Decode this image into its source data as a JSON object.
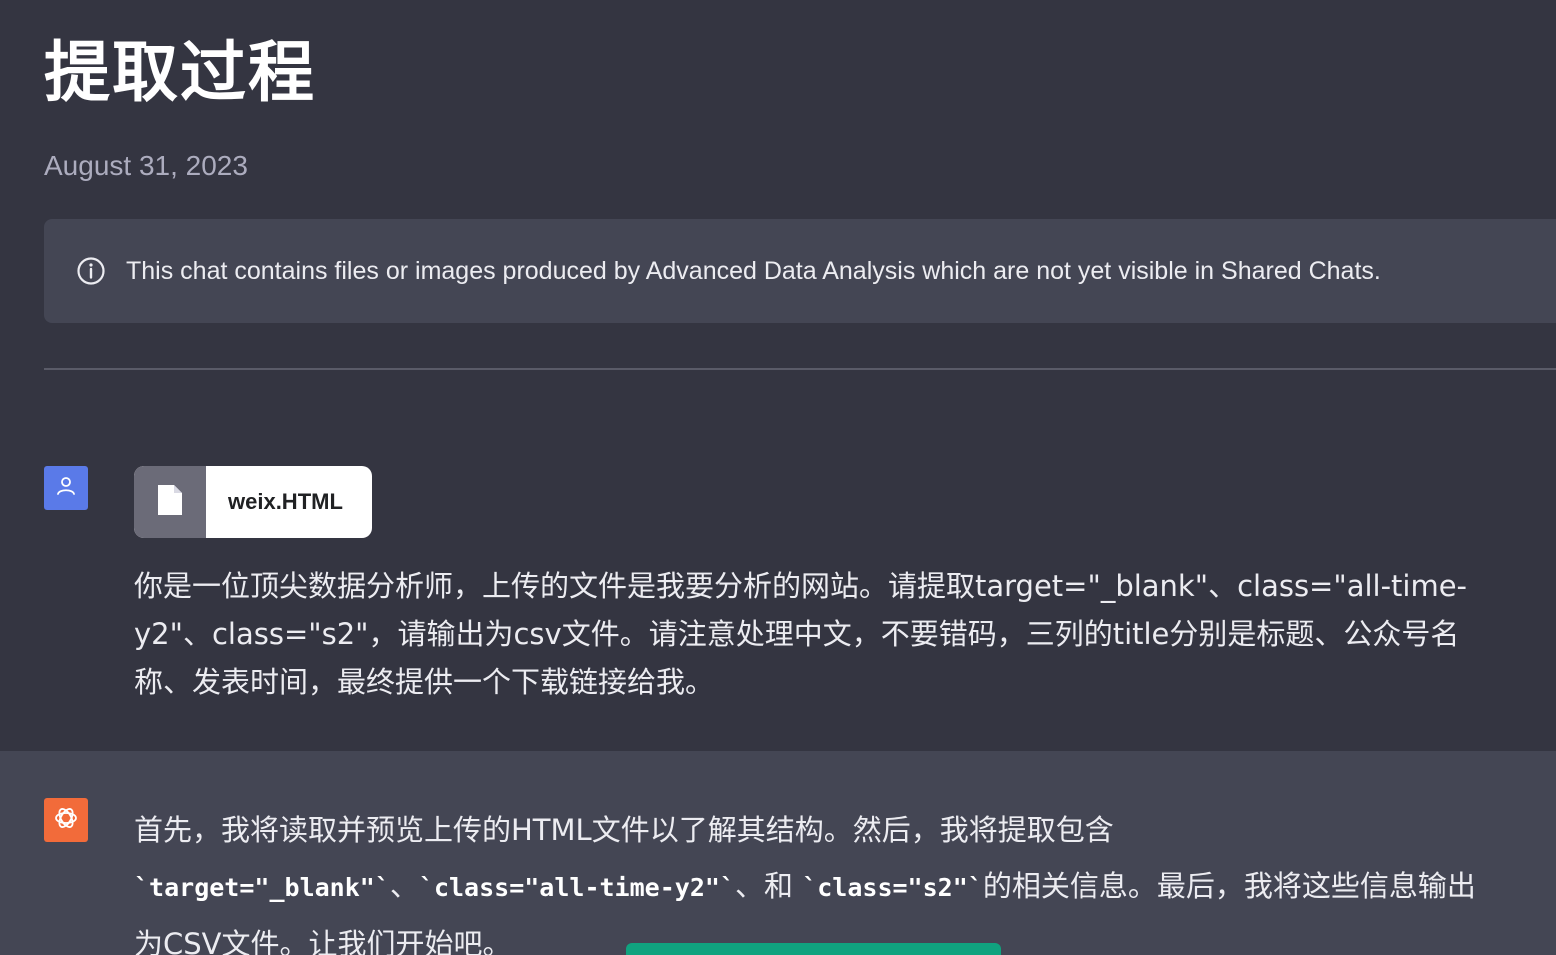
{
  "page": {
    "title": "提取过程",
    "date": "August 31, 2023"
  },
  "notice": {
    "icon": "info-icon",
    "text": "This chat contains files or images produced by Advanced Data Analysis which are not yet visible in Shared Chats."
  },
  "user_message": {
    "avatar_icon": "user-icon",
    "avatar_color": "#5a7ae8",
    "attachment": {
      "icon": "file-icon",
      "name": "weix.HTML"
    },
    "text": "你是一位顶尖数据分析师，上传的文件是我要分析的网站。请提取target=\"_blank\"、class=\"all-time-y2\"、class=\"s2\"，请输出为csv文件。请注意处理中文，不要错码，三列的title分别是标题、公众号名称、发表时间，最终提供一个下载链接给我。"
  },
  "assistant_message": {
    "avatar_icon": "openai-logo-icon",
    "avatar_color": "#f26b3a",
    "line1": "首先，我将读取并预览上传的HTML文件以了解其结构。然后，我将提取包含",
    "code1": "`target=\"_blank\"`",
    "sep1": "、",
    "code2": "`class=\"all-time-y2\"`",
    "sep2": "、和 ",
    "code3": "`class=\"s2\"`",
    "tail": "的相关信息。最后，我将这些信息输出为CSV文件。让我们开始吧。"
  },
  "colors": {
    "background": "#343541",
    "panel": "#444654",
    "accent_green": "#10a37f"
  }
}
